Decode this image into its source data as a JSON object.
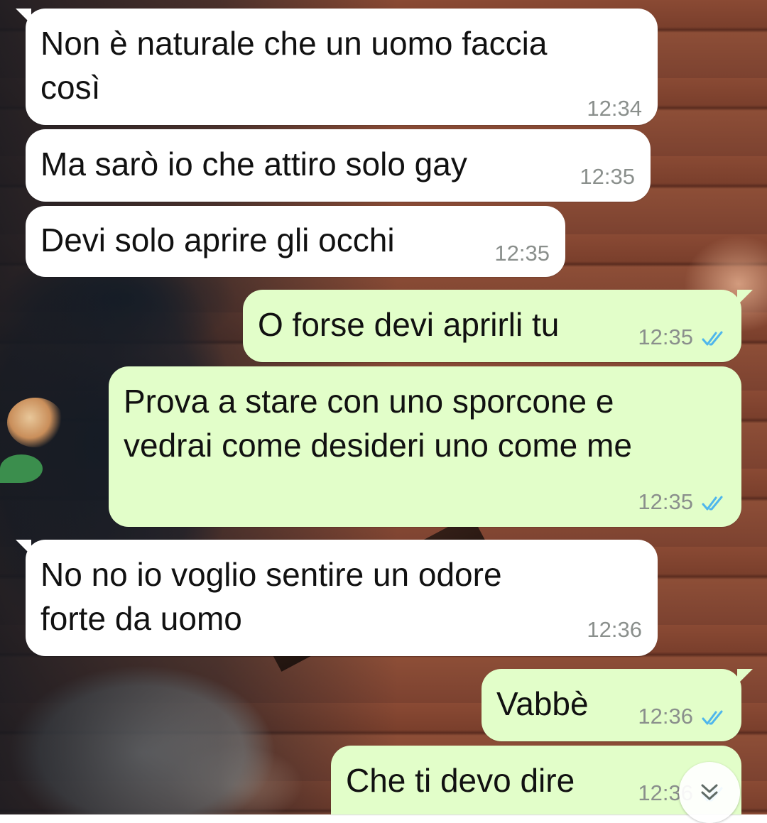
{
  "chat": {
    "messages": [
      {
        "direction": "incoming",
        "text": "Non è naturale che un uomo faccia\ncosì",
        "time": "12:34"
      },
      {
        "direction": "incoming",
        "text": "Ma sarò io che attiro solo gay",
        "time": "12:35"
      },
      {
        "direction": "incoming",
        "text": "Devi solo aprire gli occhi",
        "time": "12:35"
      },
      {
        "direction": "outgoing",
        "text": "O forse devi aprirli tu",
        "time": "12:35",
        "status_icon": "double-check-icon"
      },
      {
        "direction": "outgoing",
        "text": "Prova a stare con uno sporcone e\nvedrai come desideri uno come me",
        "time": "12:35",
        "status_icon": "double-check-icon"
      },
      {
        "direction": "incoming",
        "text": "No no io voglio sentire un odore\nforte da uomo",
        "time": "12:36"
      },
      {
        "direction": "outgoing",
        "text": "Vabbè",
        "time": "12:36",
        "status_icon": "double-check-icon"
      },
      {
        "direction": "outgoing",
        "text": "Che ti devo dire",
        "time": "12:36",
        "status_icon": "double-check-icon"
      }
    ]
  },
  "scroll_button": {
    "icon": "double-chevron-down-icon"
  },
  "colors": {
    "incoming_bubble": "#ffffff",
    "outgoing_bubble": "#e2fec9",
    "read_ticks": "#4fb6ec",
    "timestamp": "#8a8f8c"
  }
}
